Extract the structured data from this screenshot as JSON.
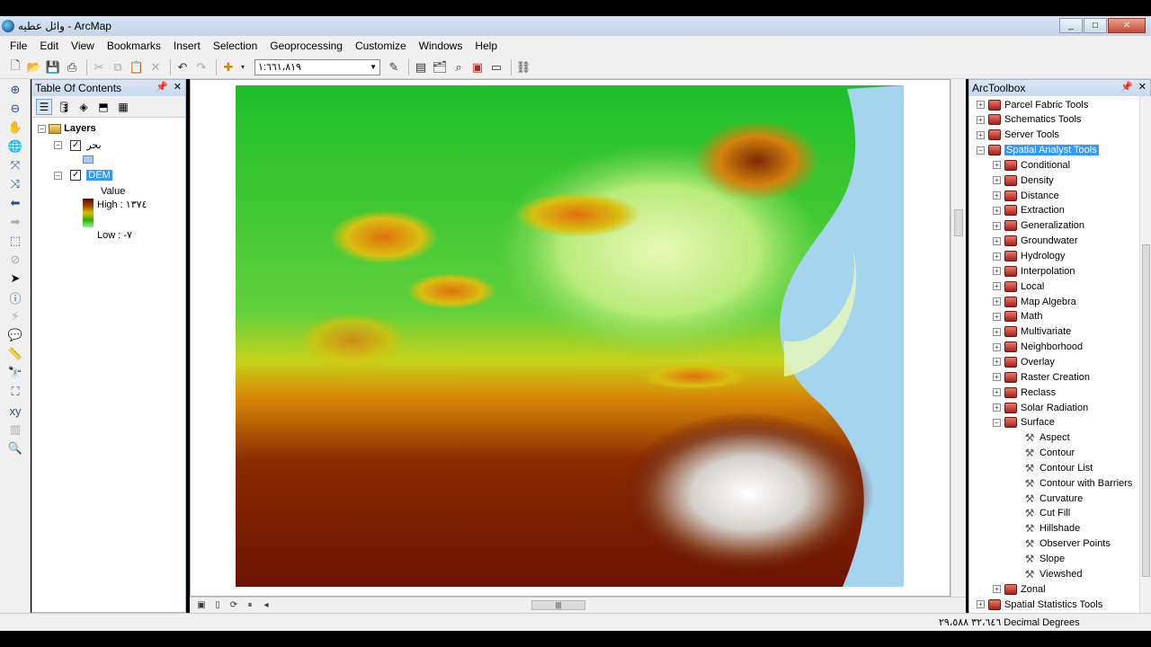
{
  "window": {
    "title": "وائل عطيه - ArcMap",
    "buttons": {
      "minimize": "_",
      "maximize": "□",
      "close": "✕"
    }
  },
  "menu": [
    "File",
    "Edit",
    "View",
    "Bookmarks",
    "Insert",
    "Selection",
    "Geoprocessing",
    "Customize",
    "Windows",
    "Help"
  ],
  "toolbar": {
    "scale_value": "١:٦٦١،٨١٩"
  },
  "toc": {
    "header": "Table Of Contents",
    "root": "Layers",
    "layers": [
      {
        "name": "بحر",
        "checked": true
      },
      {
        "name": "DEM",
        "checked": true,
        "selected": true
      }
    ],
    "legend": {
      "field": "Value",
      "high": "High : ١٣٧٤",
      "low": "Low : -٧"
    }
  },
  "arctoolbox": {
    "header": "ArcToolbox",
    "toolboxes_before": [
      "Parcel Fabric Tools",
      "Schematics Tools",
      "Server Tools"
    ],
    "expanded": "Spatial Analyst Tools",
    "sub_toolsets": [
      "Conditional",
      "Density",
      "Distance",
      "Extraction",
      "Generalization",
      "Groundwater",
      "Hydrology",
      "Interpolation",
      "Local",
      "Map Algebra",
      "Math",
      "Multivariate",
      "Neighborhood",
      "Overlay",
      "Raster Creation",
      "Reclass",
      "Solar Radiation"
    ],
    "surface_label": "Surface",
    "surface_tools": [
      "Aspect",
      "Contour",
      "Contour List",
      "Contour with Barriers",
      "Curvature",
      "Cut Fill",
      "Hillshade",
      "Observer Points",
      "Slope",
      "Viewshed"
    ],
    "after_surface": [
      "Zonal"
    ],
    "toolboxes_after": [
      "Spatial Statistics Tools"
    ]
  },
  "status": {
    "coordinates": "٣٢،٦٤٦ ٢٩،٥٨٨ Decimal Degrees"
  },
  "colors": {
    "selection": "#3399ff",
    "sea": "#a5d4ef",
    "toolbox_red": "#b5271d"
  }
}
